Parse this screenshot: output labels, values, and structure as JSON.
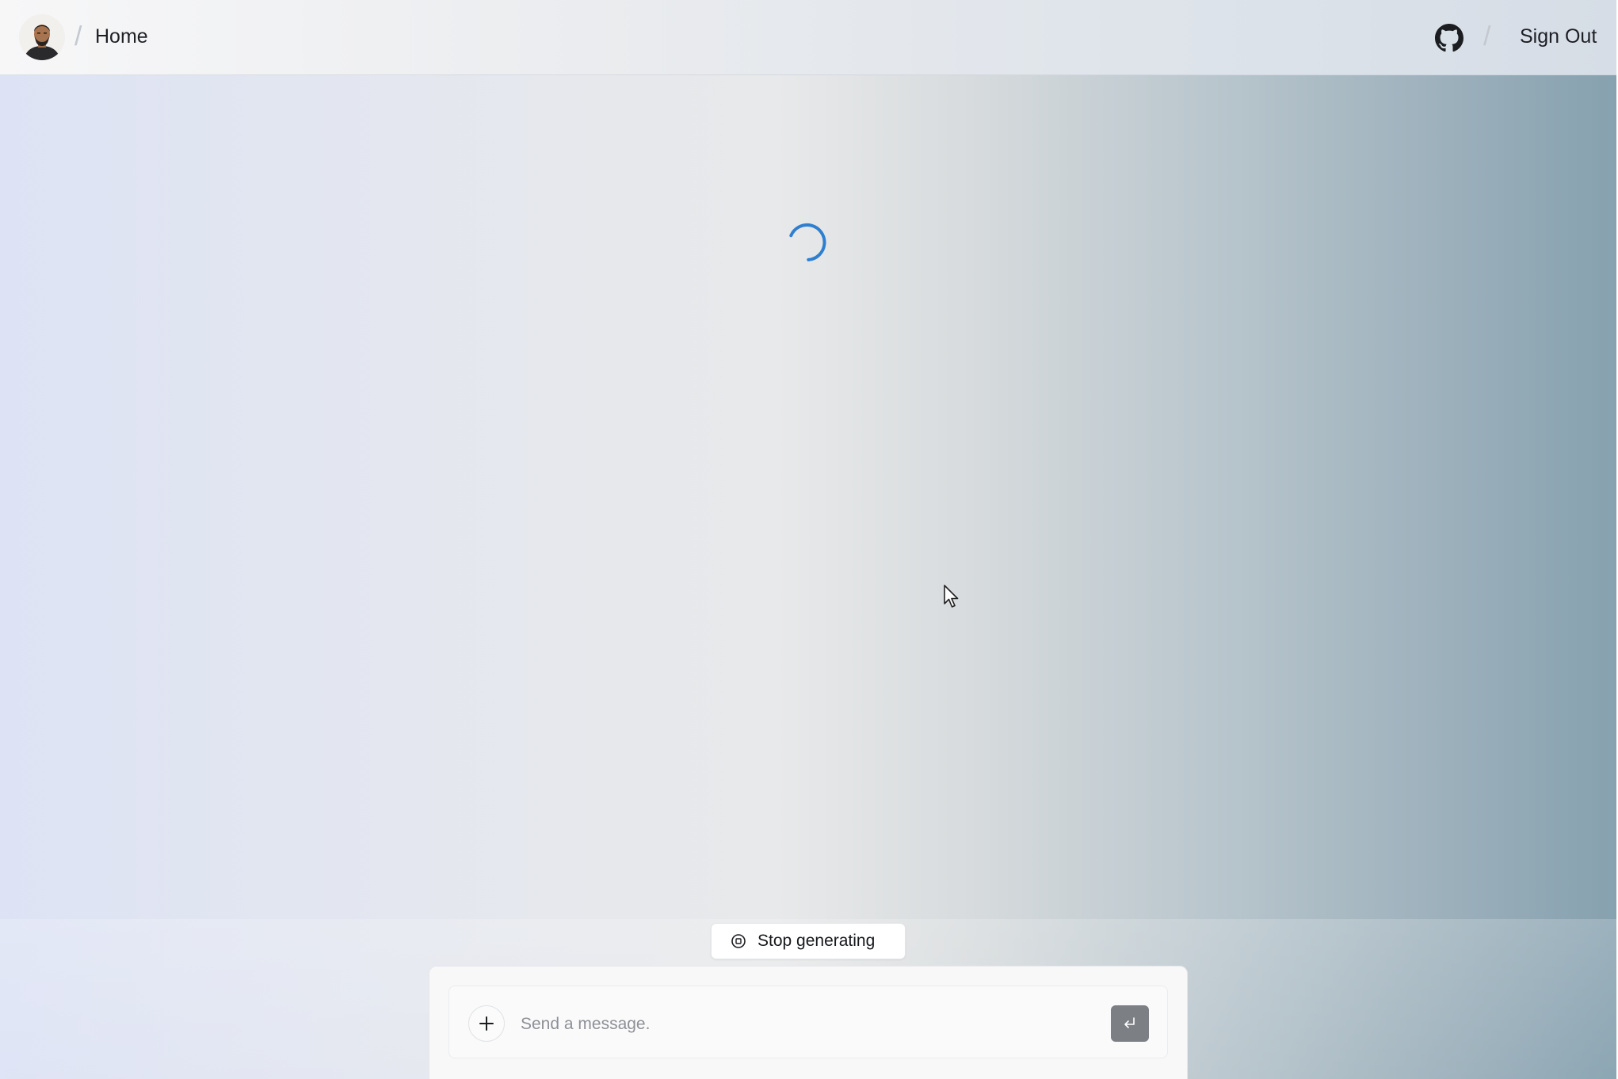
{
  "header": {
    "breadcrumb_home": "Home",
    "sign_out_label": "Sign Out",
    "avatar_icon": "user-avatar",
    "github_icon": "github-icon"
  },
  "main": {
    "loading_icon": "spinner-icon",
    "accent_color": "#2f7fd0"
  },
  "chat": {
    "stop_label": "Stop generating",
    "stop_icon": "stop-circle-icon",
    "input_placeholder": "Send a message.",
    "add_icon": "plus-icon",
    "send_icon": "enter-icon"
  }
}
